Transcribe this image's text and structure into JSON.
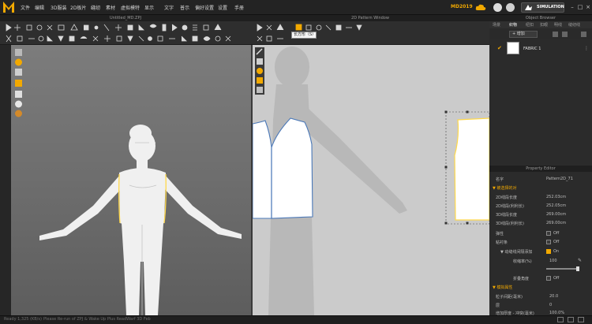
{
  "app": {
    "version_badge": "MD2019",
    "simulation_label": "SIMULATION"
  },
  "menu": [
    "文件",
    "编辑",
    "3D服装",
    "2D板片",
    "缝纫",
    "素材",
    "虚拟模特",
    "显示",
    "文字",
    "普示",
    "偏好设置",
    "设置",
    "手册"
  ],
  "window_3d": {
    "title": "Untitled_MD.ZPJ"
  },
  "window_2d": {
    "title": "2D Pattern Window",
    "tooltip": "长方形（S）"
  },
  "object_browser": {
    "title": "Object Browser",
    "tabs": [
      "场景",
      "织物",
      "纽扣",
      "扣眼",
      "明线",
      "缝纫线"
    ],
    "add_label": "+ 增加",
    "fabric_name": "FABRIC 1"
  },
  "property_editor": {
    "title": "Property Editor",
    "name_key": "名字",
    "name_value": "Pattern2D_71",
    "section_1": "▼ 被选择的对",
    "rows": [
      {
        "key": "2D线段长度",
        "value": "252.03cm"
      },
      {
        "key": "2D线段(利利长)",
        "value": "252.05cm"
      },
      {
        "key": "3D线段长度",
        "value": "269.00cm"
      },
      {
        "key": "3D线段(利利长)",
        "value": "269.00cm"
      }
    ],
    "toggle_rows": [
      {
        "key": "弹性",
        "state": "Off",
        "on": false
      },
      {
        "key": "粘衬条",
        "state": "Off",
        "on": false
      },
      {
        "key": "▼ 动缝线间隔添加",
        "state": "On",
        "on": true
      }
    ],
    "ratio_key": "收缩率(%)",
    "ratio_value": "100",
    "fold_key": "折叠角度",
    "fold_state": "Off",
    "section_2": "▼ 模拟属性",
    "sim_rows": [
      {
        "key": "粒子间距(毫米)",
        "value": "20.0"
      },
      {
        "key": "层",
        "value": "0"
      },
      {
        "key": "增加厚度 - 冲突(毫米)",
        "value": "100.0%"
      }
    ]
  },
  "status_bar": {
    "left": "Ready  1,325 (KB/s)",
    "middle": "Please Re-run of ZPJ & Wake Up Plus ReadWarf 3D Feb"
  },
  "colors": {
    "accent": "#f2a900",
    "selection": "#ffd84a",
    "pattern_outline": "#4a78b8"
  }
}
